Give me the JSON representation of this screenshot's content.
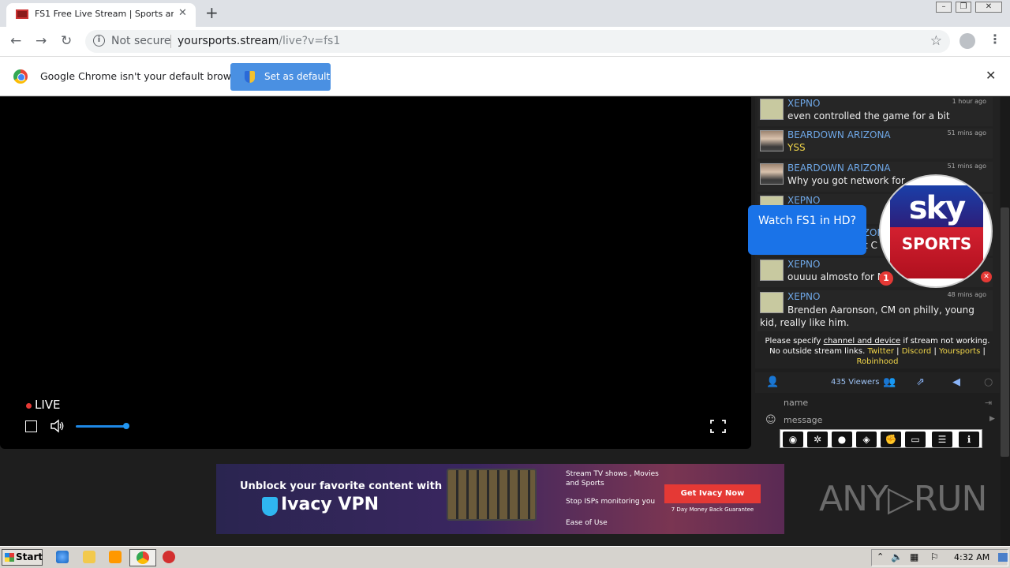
{
  "browser": {
    "tab_title": "FS1 Free Live Stream | Sports and TV",
    "security_label": "Not secure",
    "url_host": "yoursports.stream",
    "url_path": "/live?v=fs1"
  },
  "infobar": {
    "message": "Google Chrome isn't your default browser",
    "button_label": "Set as default"
  },
  "player": {
    "live_label": "LIVE",
    "volume_level": 0.82
  },
  "chat": {
    "messages": [
      {
        "user": "XEPNO",
        "time": "1 hour ago",
        "text": "even controlled the game for a bit"
      },
      {
        "user": "BEARDOWN ARIZONA",
        "time": "51 mins ago",
        "text": "YSS"
      },
      {
        "user": "BEARDOWN ARIZONA",
        "time": "51 mins ago",
        "text": "Why you got network for"
      },
      {
        "user": "XEPNO",
        "time": "",
        "text": ""
      },
      {
        "user": "BEARDOWN ARIZONA",
        "time": "",
        "text": "got C"
      },
      {
        "user": "XEPNO",
        "time": "",
        "text": "ouuuu almosto for NE"
      },
      {
        "user": "XEPNO",
        "time": "48 mins ago",
        "text": "Brenden Aaronson, CM on philly, young kid, really like him."
      }
    ],
    "notice_line1_a": "Please specify ",
    "notice_link": "channel and device",
    "notice_line1_b": " if stream not working.",
    "notice_line2": "No outside stream links. ",
    "notice_links": [
      "Twitter",
      "Discord",
      "Yoursports",
      "Robinhood"
    ],
    "notice_sep": " | ",
    "viewers": "435 Viewers",
    "name_placeholder": "name",
    "message_placeholder": "message"
  },
  "popup": {
    "bubble_text": "Watch FS1 in HD?",
    "badge_count": "1",
    "logo_top": "sky",
    "logo_bottom": "SPORTS"
  },
  "ad": {
    "headline": "Unblock your favorite content with",
    "brand": "Ivacy VPN",
    "points": [
      "Stream TV shows , Movies",
      "and Sports",
      "Stop ISPs monitoring you",
      "Ease of Use"
    ],
    "cta": "Get Ivacy Now",
    "guarantee": "7 Day Money Back Guarantee"
  },
  "watermark": "ANY▷RUN",
  "taskbar": {
    "start_label": "Start",
    "clock": "4:32 AM"
  }
}
